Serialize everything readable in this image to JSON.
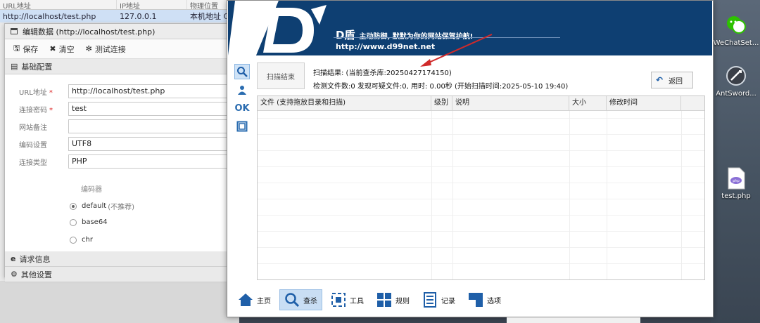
{
  "colors": {
    "banner": "#0e3f72",
    "selected": "#c9def4",
    "icon_blue": "#1f5fa8",
    "arrow": "#d02a2a"
  },
  "antsword": {
    "columns": [
      "URL地址",
      "IP地址",
      "物理位置"
    ],
    "row": {
      "url": "http://localhost/test.php",
      "ip": "127.0.0.1",
      "location": "本机地址 C"
    }
  },
  "dialog": {
    "title": "编辑数据 (http://localhost/test.php)",
    "title_icon": "window-icon",
    "toolbar": {
      "save": "保存",
      "clear": "清空",
      "test": "测试连接"
    },
    "sections": {
      "basic": "基础配置",
      "request": "请求信息",
      "other": "其他设置"
    },
    "fields": {
      "url_label": "URL地址",
      "url_value": "http://localhost/test.php",
      "pwd_label": "连接密码",
      "pwd_value": "test",
      "note_label": "网站备注",
      "note_value": "",
      "encoding_label": "编码设置",
      "encoding_value": "UTF8",
      "type_label": "连接类型",
      "type_value": "PHP"
    },
    "encoder": {
      "title": "编码器",
      "options": [
        {
          "label": "default",
          "note": "(不推荐)",
          "checked": true
        },
        {
          "label": "base64",
          "note": "",
          "checked": false
        },
        {
          "label": "chr",
          "note": "",
          "checked": false
        }
      ]
    }
  },
  "dshield": {
    "brand": "D盾",
    "slogan": "主动防御, 默默为你的网站保驾护航!",
    "url": "http://www.d99net.net",
    "scan_button": "扫描结束",
    "result_line1": "扫描结果: (当前查杀库:20250427174150)",
    "result_line2": "检测文件数:0 发现可疑文件:0, 用时: 0.00秒 (开始扫描时间:2025-05-10 19:40)",
    "return_button": "返回",
    "side_ok": "OK",
    "table_headers": [
      "文件 (支持拖放目录和扫描)",
      "级别",
      "说明",
      "大小",
      "修改时间"
    ],
    "nav": [
      {
        "label": "主页",
        "icon": "home-icon",
        "selected": false
      },
      {
        "label": "查杀",
        "icon": "search-icon",
        "selected": true
      },
      {
        "label": "工具",
        "icon": "tools-icon",
        "selected": false
      },
      {
        "label": "规则",
        "icon": "rules-icon",
        "selected": false
      },
      {
        "label": "记录",
        "icon": "log-icon",
        "selected": false
      },
      {
        "label": "选项",
        "icon": "options-icon",
        "selected": false
      }
    ]
  },
  "desktop": {
    "icons": [
      {
        "label": "WeChatSet...",
        "icon": "wechat-icon"
      },
      {
        "label": "AntSword...",
        "icon": "antsword-icon"
      },
      {
        "label": "test.php",
        "icon": "php-file-icon"
      }
    ]
  }
}
